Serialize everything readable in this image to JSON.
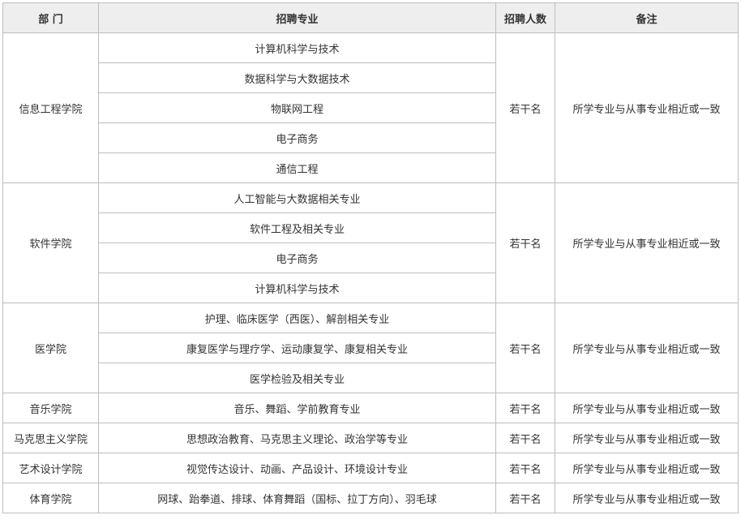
{
  "headers": {
    "department": "部 门",
    "major": "招聘专业",
    "count": "招聘人数",
    "note": "备注"
  },
  "groups": [
    {
      "department": "信息工程学院",
      "majors": [
        "计算机科学与技术",
        "数据科学与大数据技术",
        "物联网工程",
        "电子商务",
        "通信工程"
      ],
      "count": "若干名",
      "note": "所学专业与从事专业相近或一致"
    },
    {
      "department": "软件学院",
      "majors": [
        "人工智能与大数据相关专业",
        "软件工程及相关专业",
        "电子商务",
        "计算机科学与技术"
      ],
      "count": "若干名",
      "note": "所学专业与从事专业相近或一致"
    },
    {
      "department": "医学院",
      "majors": [
        "护理、临床医学（西医）、解剖相关专业",
        "康复医学与理疗学、运动康复学、康复相关专业",
        "医学检验及相关专业"
      ],
      "count": "若干名",
      "note": "所学专业与从事专业相近或一致"
    },
    {
      "department": "音乐学院",
      "majors": [
        "音乐、舞蹈、学前教育专业"
      ],
      "count": "若干名",
      "note": "所学专业与从事专业相近或一致"
    },
    {
      "department": "马克思主义学院",
      "majors": [
        "思想政治教育、马克思主义理论、政治学等专业"
      ],
      "count": "若干名",
      "note": "所学专业与从事专业相近或一致"
    },
    {
      "department": "艺术设计学院",
      "majors": [
        "视觉传达设计、动画、产品设计、环境设计专业"
      ],
      "count": "若干名",
      "note": "所学专业与从事专业相近或一致"
    },
    {
      "department": "体育学院",
      "majors": [
        "网球、跆拳道、排球、体育舞蹈（国标、拉丁方向）、羽毛球"
      ],
      "count": "若干名",
      "note": "所学专业与从事专业相近或一致"
    }
  ]
}
